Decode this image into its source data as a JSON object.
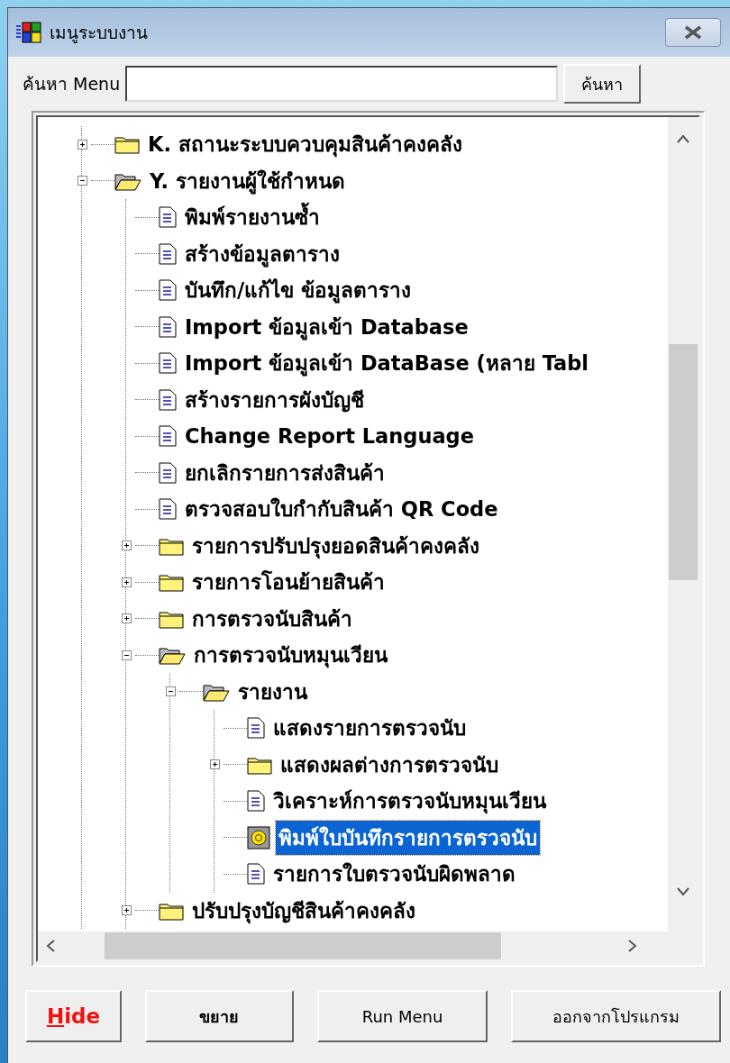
{
  "window": {
    "title": "เมนูระบบงาน"
  },
  "search": {
    "label": "ค้นหา Menu",
    "button": "ค้นหา"
  },
  "tree": [
    {
      "label": "K. สถานะระบบควบคุมสินค้าคงคลัง",
      "kind": "folder",
      "expanded": false,
      "selected": false
    },
    {
      "label": "Y. รายงานผู้ใช้กำหนด",
      "kind": "folder",
      "expanded": true,
      "selected": false,
      "children": [
        {
          "label": "พิมพ์รายงานซ้ำ",
          "kind": "document",
          "selected": false
        },
        {
          "label": "สร้างข้อมูลตาราง",
          "kind": "document",
          "selected": false
        },
        {
          "label": "บันทึก/แก้ไข ข้อมูลตาราง",
          "kind": "document",
          "selected": false
        },
        {
          "label": "Import ข้อมูลเข้า Database",
          "kind": "document",
          "selected": false
        },
        {
          "label": "Import ข้อมูลเข้า DataBase (หลาย Tabl",
          "kind": "document",
          "selected": false
        },
        {
          "label": "สร้างรายการผังบัญชี",
          "kind": "document",
          "selected": false
        },
        {
          "label": "Change Report Language",
          "kind": "document",
          "selected": false
        },
        {
          "label": "ยกเลิกรายการส่งสินค้า",
          "kind": "document",
          "selected": false
        },
        {
          "label": "ตรวจสอบใบกำกับสินค้า QR Code",
          "kind": "document",
          "selected": false
        },
        {
          "label": "รายการปรับปรุงยอดสินค้าคงคลัง",
          "kind": "folder",
          "expanded": false,
          "selected": false
        },
        {
          "label": "รายการโอนย้ายสินค้า",
          "kind": "folder",
          "expanded": false,
          "selected": false
        },
        {
          "label": "การตรวจนับสินค้า",
          "kind": "folder",
          "expanded": false,
          "selected": false
        },
        {
          "label": "การตรวจนับหมุนเวียน",
          "kind": "folder",
          "expanded": true,
          "selected": false,
          "children": [
            {
              "label": "รายงาน",
              "kind": "folder",
              "expanded": true,
              "selected": false,
              "children": [
                {
                  "label": "แสดงรายการตรวจนับ",
                  "kind": "document",
                  "selected": false
                },
                {
                  "label": "แสดงผลต่างการตรวจนับ",
                  "kind": "folder",
                  "expanded": false,
                  "selected": false
                },
                {
                  "label": "วิเคราะห์การตรวจนับหมุนเวียน",
                  "kind": "document",
                  "selected": false
                },
                {
                  "label": "พิมพ์ใบบันทึกรายการตรวจนับ",
                  "kind": "special",
                  "selected": true
                },
                {
                  "label": "รายการใบตรวจนับผิดพลาด",
                  "kind": "document",
                  "selected": false
                }
              ]
            }
          ]
        },
        {
          "label": "ปรับปรุงบัญชีสินค้าคงคลัง",
          "kind": "folder",
          "expanded": false,
          "selected": false
        }
      ]
    }
  ],
  "buttons": [
    {
      "label": "Hide",
      "kind": "red",
      "underline_first": true
    },
    {
      "label": "ขยาย",
      "kind": "bold",
      "underline_first": false
    },
    {
      "label": "Run Menu",
      "kind": "plain",
      "underline_first": false
    },
    {
      "label": "ออกจากโปรแกรม",
      "kind": "plain",
      "underline_first": false
    }
  ]
}
